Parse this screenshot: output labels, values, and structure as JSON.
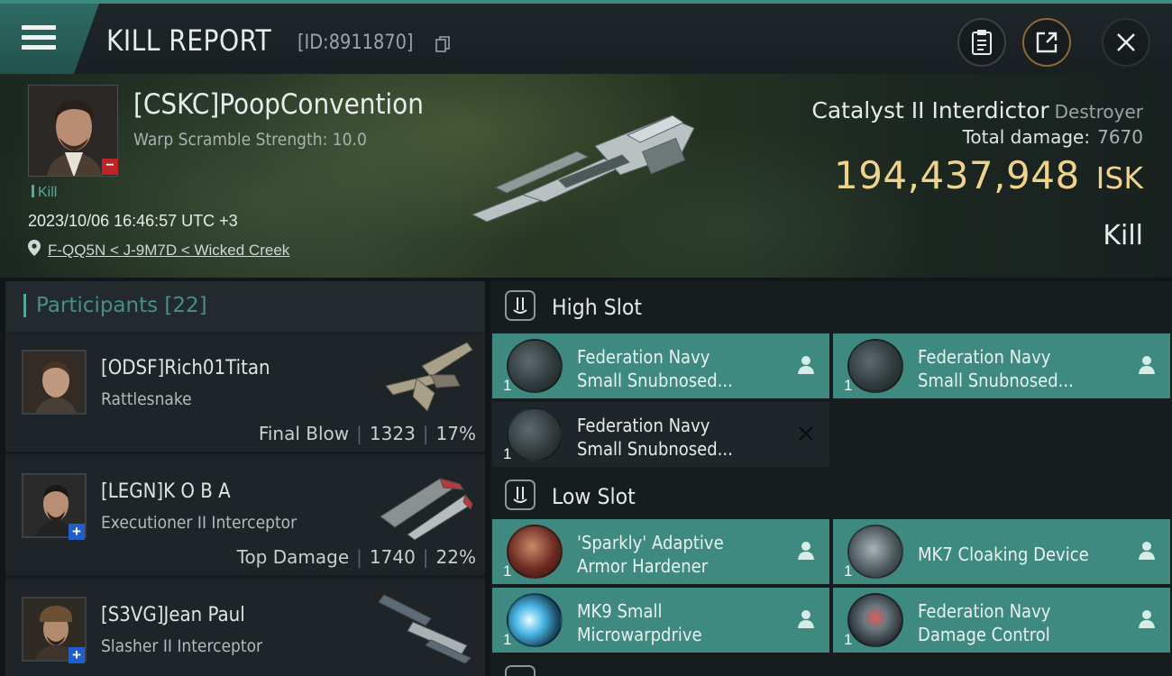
{
  "header": {
    "title": "KILL REPORT",
    "kill_id": "[ID:8911870]",
    "icons": [
      "menu-icon",
      "copy-icon",
      "clipboard-icon",
      "share-icon",
      "close-icon"
    ],
    "accent": "#3f8a80"
  },
  "victim": {
    "name": "[CSKC]PoopConvention",
    "subtitle": "Warp Scramble Strength: 10.0",
    "tag": "Kill",
    "time": "2023/10/06 16:46:57 UTC +3",
    "location": "F-QQ5N < J-9M7D < Wicked Creek",
    "ship": "Catalyst II Interdictor",
    "ship_class": "Destroyer",
    "total_damage_label": "Total damage:",
    "total_damage": "7670",
    "isk_value": "194,437,948",
    "isk_unit": "ISK",
    "result": "Kill",
    "isk_color": "#f0d38a"
  },
  "participants": {
    "label": "Participants",
    "count": "[22]",
    "rows": [
      {
        "name": "[ODSF]Rich01Titan",
        "ship": "Rattlesnake",
        "role": "Final Blow",
        "damage": "1323",
        "percent": "17%",
        "badge": ""
      },
      {
        "name": "[LEGN]K O B A",
        "ship": "Executioner II Interceptor",
        "role": "Top Damage",
        "damage": "1740",
        "percent": "22%",
        "badge": "+"
      },
      {
        "name": "[S3VG]Jean Paul",
        "ship": "Slasher II Interceptor",
        "role": "",
        "damage": "",
        "percent": "",
        "badge": "+"
      }
    ]
  },
  "fitting": {
    "high_slot": {
      "title": "High Slot",
      "modules": [
        {
          "line1": "Federation Navy",
          "line2": "Small Snubnosed...",
          "qty": "1",
          "state": "dropped"
        },
        {
          "line1": "Federation Navy",
          "line2": "Small Snubnosed...",
          "qty": "1",
          "state": "dropped"
        },
        {
          "line1": "Federation Navy",
          "line2": "Small Snubnosed...",
          "qty": "1",
          "state": "destroyed"
        }
      ]
    },
    "low_slot": {
      "title": "Low Slot",
      "modules": [
        {
          "line1": "'Sparkly' Adaptive",
          "line2": "Armor Hardener",
          "qty": "1",
          "state": "dropped"
        },
        {
          "line1": "MK7 Cloaking Device",
          "line2": "",
          "qty": "1",
          "state": "dropped"
        },
        {
          "line1": "MK9 Small",
          "line2": "Microwarpdrive",
          "qty": "1",
          "state": "dropped"
        },
        {
          "line1": "Federation Navy",
          "line2": "Damage Control",
          "qty": "1",
          "state": "dropped"
        }
      ]
    }
  }
}
